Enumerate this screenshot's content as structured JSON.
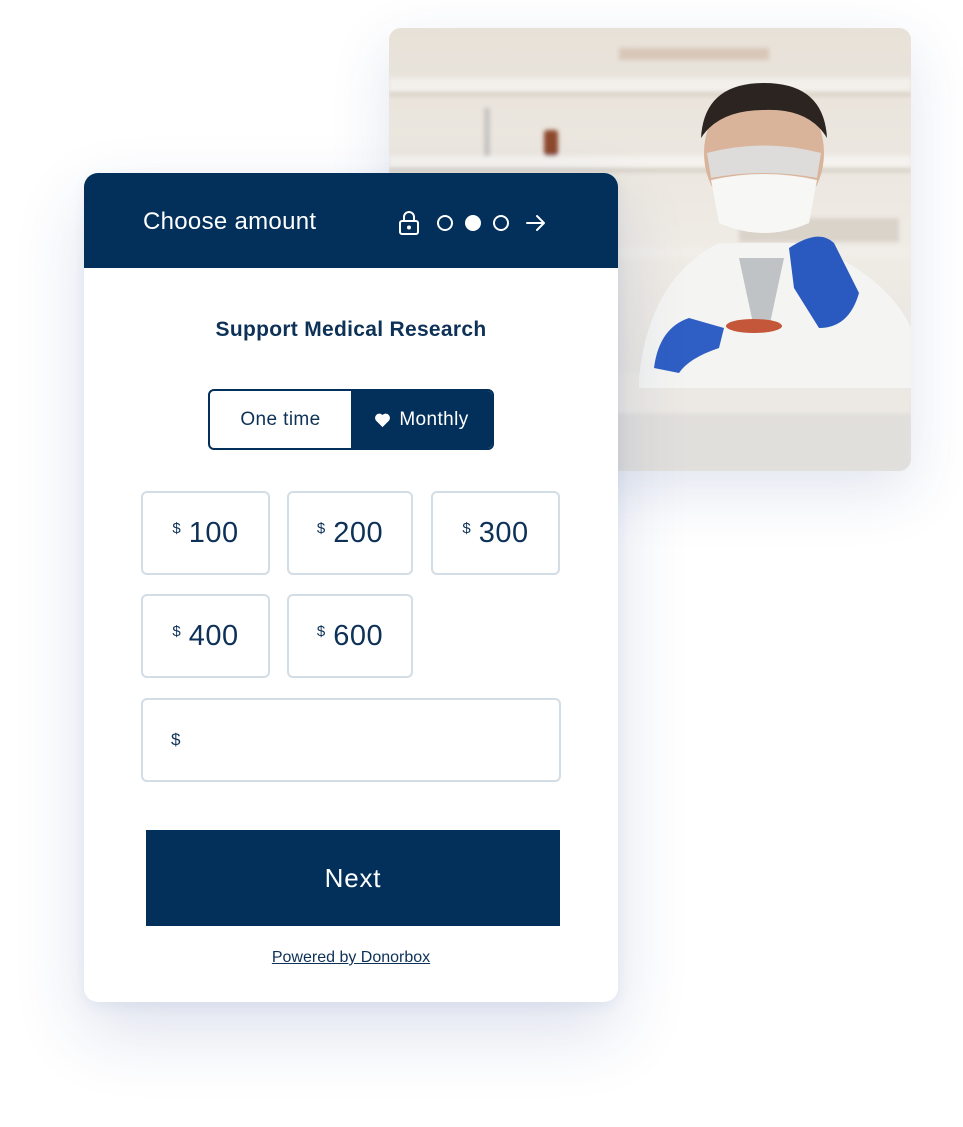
{
  "photo": {
    "alt": "Scientist in lab coat, mask and goggles holding a petri dish"
  },
  "form": {
    "header": {
      "title": "Choose amount",
      "icons": [
        "lock-icon",
        "step-dot-empty",
        "step-dot-filled",
        "step-dot-empty",
        "arrow-right-icon"
      ],
      "current_step": 2,
      "total_steps": 3
    },
    "campaign_title": "Support Medical Research",
    "frequency": {
      "options": [
        {
          "label": "One time",
          "selected": false
        },
        {
          "label": "Monthly",
          "selected": true,
          "icon": "heart-icon"
        }
      ]
    },
    "amounts": [
      {
        "currency": "$",
        "value": "100"
      },
      {
        "currency": "$",
        "value": "200"
      },
      {
        "currency": "$",
        "value": "300"
      },
      {
        "currency": "$",
        "value": "400"
      },
      {
        "currency": "$",
        "value": "600"
      }
    ],
    "custom_amount": {
      "currency": "$",
      "value": "",
      "placeholder": ""
    },
    "next_label": "Next",
    "powered_by": "Powered by Donorbox"
  },
  "colors": {
    "primary": "#02305a",
    "text": "#0d3157",
    "border": "#d3dde6"
  }
}
